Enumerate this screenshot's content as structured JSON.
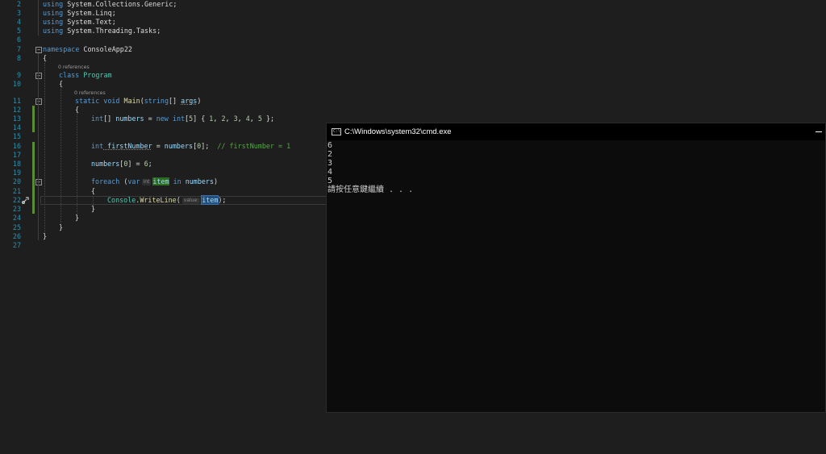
{
  "editor": {
    "line_numbers": [
      "2",
      "3",
      "4",
      "5",
      "6",
      "7",
      "8",
      "9",
      "10",
      "11",
      "12",
      "13",
      "14",
      "15",
      "16",
      "17",
      "18",
      "19",
      "20",
      "21",
      "22",
      "23",
      "24",
      "25",
      "26",
      "27"
    ],
    "codelens": [
      "0 references",
      "0 references"
    ],
    "lines": {
      "l2a": "using",
      "l2b": " System.Collections.Generic;",
      "l3a": "using",
      "l3b": " System.Linq;",
      "l4a": "using",
      "l4b": " System.Text;",
      "l5a": "using",
      "l5b": " System.Threading.Tasks;",
      "l7a": "namespace",
      "l7b": " ConsoleApp22",
      "l8": "{",
      "l9a": "class",
      "l9b": " Program",
      "l10": "{",
      "l11a": "static",
      "l11b": " void",
      "l11c": " Main",
      "l11d": "(",
      "l11e": "string",
      "l11f": "[] ",
      "l11g": "args",
      "l11h": ")",
      "l12": "{",
      "l13a": "int",
      "l13b": "[] ",
      "l13c": "numbers",
      "l13d": " = ",
      "l13e": "new",
      "l13f": " int",
      "l13g": "[",
      "l13h": "5",
      "l13i": "] { ",
      "l13j": "1",
      "l13k": ", ",
      "l13l": "2",
      "l13m": ", ",
      "l13n": "3",
      "l13o": ", ",
      "l13p": "4",
      "l13q": ", ",
      "l13r": "5",
      "l13s": " };",
      "l16a": "int",
      "l16b": " firstNumber",
      "l16c": " = ",
      "l16d": "numbers",
      "l16e": "[",
      "l16f": "0",
      "l16g": "];  ",
      "l16h": "// firstNumber = 1",
      "l18a": "numbers",
      "l18b": "[",
      "l18c": "0",
      "l18d": "] = ",
      "l18e": "6",
      "l18f": ";",
      "l20a": "foreach",
      "l20b": " (",
      "l20c": "var",
      "l20d": "int",
      "l20e": "item",
      "l20f": " in",
      "l20g": " numbers",
      "l20h": ")",
      "l21": "{",
      "l22a": "Console",
      "l22b": ".",
      "l22c": "WriteLine",
      "l22d": "(",
      "l22e": "value:",
      "l22f": "item",
      "l22g": ");",
      "l23": "}",
      "l24": "}",
      "l25": "}",
      "l26": "}"
    }
  },
  "cmd_window": {
    "title": "C:\\Windows\\system32\\cmd.exe",
    "icon": "cmd-icon",
    "icon_text": "C:\\",
    "output": [
      "6",
      "2",
      "3",
      "4",
      "5",
      "請按任意鍵繼續 . . ."
    ]
  },
  "colors": {
    "editor_bg": "#1e1e1e",
    "keyword": "#569cd6",
    "type": "#4ec9b0",
    "method": "#dcdcaa",
    "identifier": "#9cdcfe",
    "number": "#b5cea8",
    "comment": "#57a64a",
    "line_number": "#2b91af",
    "console_bg": "#0c0c0c"
  }
}
